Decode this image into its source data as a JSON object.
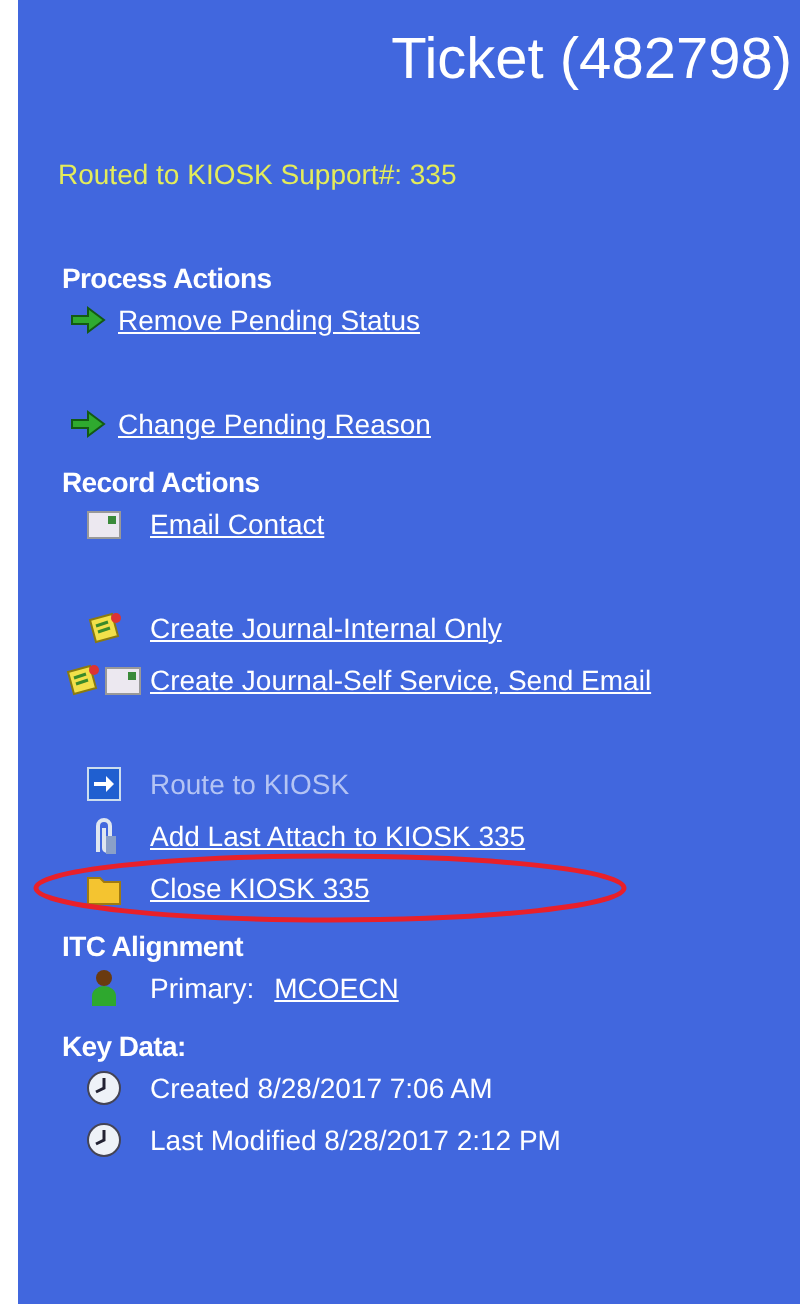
{
  "title": "Ticket (482798)",
  "routed_to": "Routed to KIOSK Support#: 335",
  "sections": [
    {
      "heading": "Process Actions",
      "groups": [
        [
          {
            "kind": "arrow",
            "label": "Remove Pending Status",
            "link": true,
            "disabled": false
          }
        ],
        [
          {
            "kind": "arrow",
            "label": "Change Pending Reason",
            "link": true,
            "disabled": false
          }
        ]
      ]
    },
    {
      "heading": "Record Actions",
      "groups": [
        [
          {
            "kind": "email",
            "label": "Email Contact",
            "link": true,
            "disabled": false
          }
        ],
        [
          {
            "kind": "journal",
            "label": "Create Journal-Internal Only",
            "link": true,
            "disabled": false
          },
          {
            "kind": "journal-email",
            "label": "Create Journal-Self Service, Send Email",
            "link": true,
            "disabled": false
          }
        ],
        [
          {
            "kind": "route",
            "label": "Route to KIOSK",
            "link": true,
            "disabled": true
          },
          {
            "kind": "attach",
            "label": "Add Last Attach to KIOSK 335",
            "link": true,
            "disabled": false
          },
          {
            "kind": "folder",
            "label": "Close KIOSK 335",
            "link": true,
            "disabled": false,
            "circled": true
          }
        ]
      ]
    },
    {
      "heading": "ITC Alignment",
      "groups": [
        [
          {
            "kind": "person",
            "prefix": "Primary:",
            "label": "MCOECN",
            "link": true,
            "disabled": false
          }
        ]
      ]
    },
    {
      "heading": "Key Data:",
      "groups": [
        [
          {
            "kind": "clock",
            "label": "Created 8/28/2017 7:06 AM",
            "link": false,
            "disabled": false
          },
          {
            "kind": "clock",
            "label": "Last Modified 8/28/2017 2:12 PM",
            "link": false,
            "disabled": false
          }
        ]
      ]
    }
  ]
}
